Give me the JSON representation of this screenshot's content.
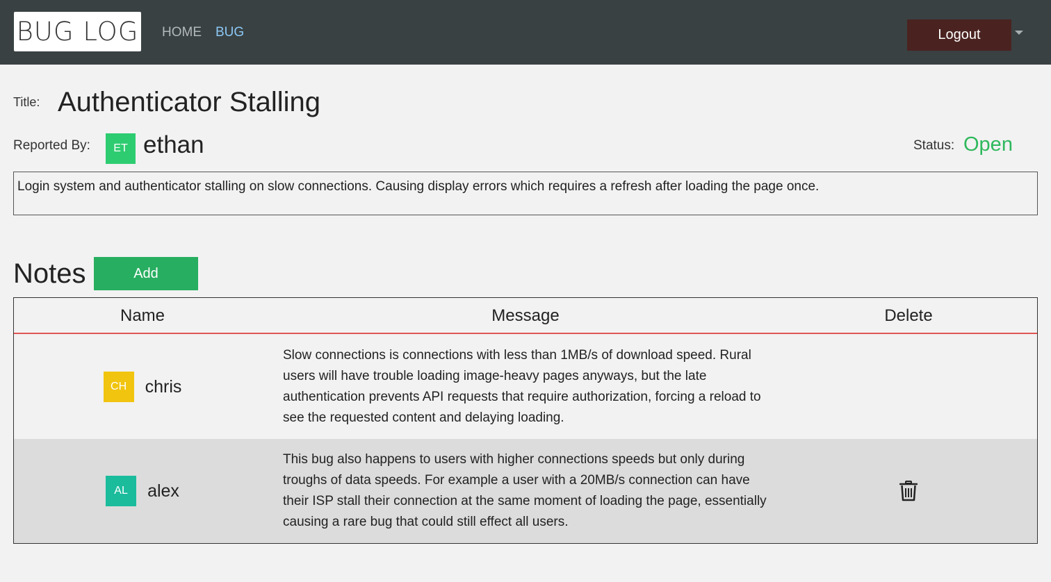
{
  "navbar": {
    "logo_text": "BUG LOG",
    "links": [
      {
        "label": "HOME"
      },
      {
        "label": "BUG"
      }
    ],
    "logout_label": "Logout"
  },
  "bug": {
    "title_label": "Title:",
    "title": "Authenticator Stalling",
    "reported_by_label": "Reported By:",
    "reporter": {
      "initials": "ET",
      "name": "ethan",
      "color": "#2ecc71"
    },
    "status_label": "Status:",
    "status": "Open",
    "status_color": "#2eb85c",
    "description": "Login system and authenticator stalling on slow connections. Causing display errors which requires a refresh after loading the page once."
  },
  "notes": {
    "heading": "Notes",
    "add_label": "Add",
    "columns": [
      "Name",
      "Message",
      "Delete"
    ],
    "rows": [
      {
        "initials": "CH",
        "name": "chris",
        "avatar_color": "#f1c40f",
        "message": "Slow connections is connections with less than 1MB/s of download speed. Rural users will have trouble loading image-heavy pages anyways, but the late authentication prevents API requests that require authorization, forcing a reload to see the requested content and delaying loading.",
        "deletable": false
      },
      {
        "initials": "AL",
        "name": "alex",
        "avatar_color": "#1abc9c",
        "message": "This bug also happens to users with higher connections speeds but only during troughs of data speeds. For example a user with a 20MB/s connection can have their ISP stall their connection at the same moment of loading the page, essentially causing a rare bug that could still effect all users.",
        "deletable": true,
        "delete_icon": "trash-icon"
      }
    ]
  }
}
